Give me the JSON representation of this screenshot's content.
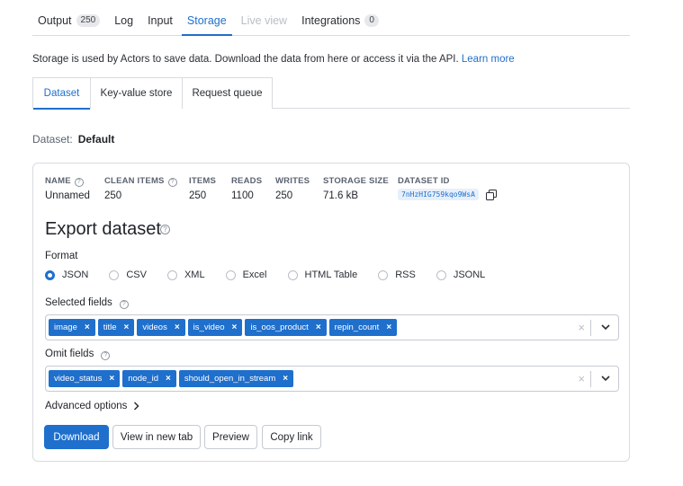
{
  "tabs": [
    {
      "label": "Output",
      "badge": "250"
    },
    {
      "label": "Log"
    },
    {
      "label": "Input"
    },
    {
      "label": "Storage"
    },
    {
      "label": "Live view"
    },
    {
      "label": "Integrations",
      "badge": "0"
    }
  ],
  "info": {
    "text": "Storage is used by Actors to save data. Download the data from here or access it via the API.",
    "link": "Learn more"
  },
  "subtabs": [
    "Dataset",
    "Key-value store",
    "Request queue"
  ],
  "dataset": {
    "label": "Dataset:",
    "value": "Default"
  },
  "meta": {
    "name_label": "NAME",
    "name_value": "Unnamed",
    "clean_label": "CLEAN ITEMS",
    "clean_value": "250",
    "items_label": "ITEMS",
    "items_value": "250",
    "reads_label": "READS",
    "reads_value": "1100",
    "writes_label": "WRITES",
    "writes_value": "250",
    "size_label": "STORAGE SIZE",
    "size_value": "71.6 kB",
    "id_label": "DATASET ID",
    "id_value": "7nHzHIG759kqo9WsA"
  },
  "export": {
    "title": "Export dataset",
    "format_label": "Format",
    "formats": [
      "JSON",
      "CSV",
      "XML",
      "Excel",
      "HTML Table",
      "RSS",
      "JSONL"
    ],
    "selected_format": "JSON",
    "selected_fields_label": "Selected fields",
    "selected_fields": [
      "image",
      "title",
      "videos",
      "is_video",
      "is_oos_product",
      "repin_count"
    ],
    "omit_fields_label": "Omit fields",
    "omit_fields": [
      "video_status",
      "node_id",
      "should_open_in_stream"
    ],
    "advanced_label": "Advanced options"
  },
  "buttons": {
    "download": "Download",
    "new_tab": "View in new tab",
    "preview": "Preview",
    "copy": "Copy link"
  },
  "colors": {
    "accent": "#1f6fcc",
    "border": "#d8dbe0"
  }
}
